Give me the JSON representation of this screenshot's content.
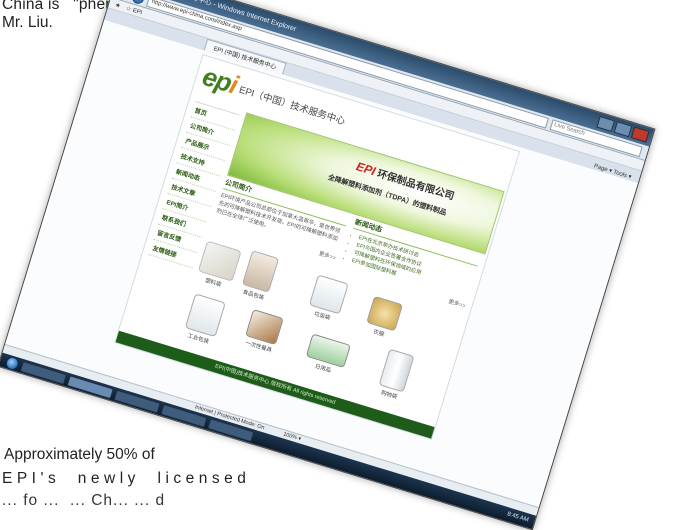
{
  "article": {
    "line1": "China is   \"phenomenal\",  says",
    "line2": "Mr. Liu.",
    "line3": "Approximately 50% of",
    "line4": "EPI's  newly  licensed",
    "line5": "... fo ...  ... Ch... ... d"
  },
  "browser": {
    "window_title": "EPI (中国) 技术服务中心 - Windows Internet Explorer",
    "url": "http://www.epi-china.com/index.asp",
    "search_placeholder": "Live Search",
    "favorites_label": "☆ EPI",
    "tab_label": "EPI (中国) 技术服务中心",
    "tools": "Page ▾   Tools ▾",
    "status_text": "Internet | Protected Mode: On",
    "zoom": "100% ▾"
  },
  "site": {
    "logo": "epi",
    "title": "EPI（中国）技术服务中心",
    "nav": [
      "首页",
      "公司简介",
      "产品展示",
      "技术支持",
      "新闻动态",
      "技术文章",
      "EPI简介",
      "联系我们",
      "留言反馈",
      "友情链接"
    ],
    "banner_brand": "EPI",
    "banner_line1": "环保制品有限公司",
    "banner_line2": "全降解塑料添加剂（TDPA）的塑料制品",
    "news_heading": "公司简介",
    "news_text": "EPI环境产品公司总部位于加拿大温哥华，是世界领先的可降解塑料技术开发商。EPI的可降解塑料添加剂已在全球广泛使用。",
    "more": "更多>>",
    "updates_heading": "新闻动态",
    "updates": [
      "EPI在北京举办技术研讨会",
      "EPI与国内企业签署合作协议",
      "可降解塑料在环保领域的应用",
      "EPI参加国际塑料展"
    ],
    "products": [
      "塑料袋",
      "食品包装",
      "垃圾袋",
      "农膜",
      "工业包装",
      "一次性餐具",
      "日用品",
      "购物袋"
    ],
    "footer": "EPI(中国)技术服务中心 版权所有 All rights reserved"
  },
  "taskbar": {
    "clock": "8:45 AM"
  }
}
